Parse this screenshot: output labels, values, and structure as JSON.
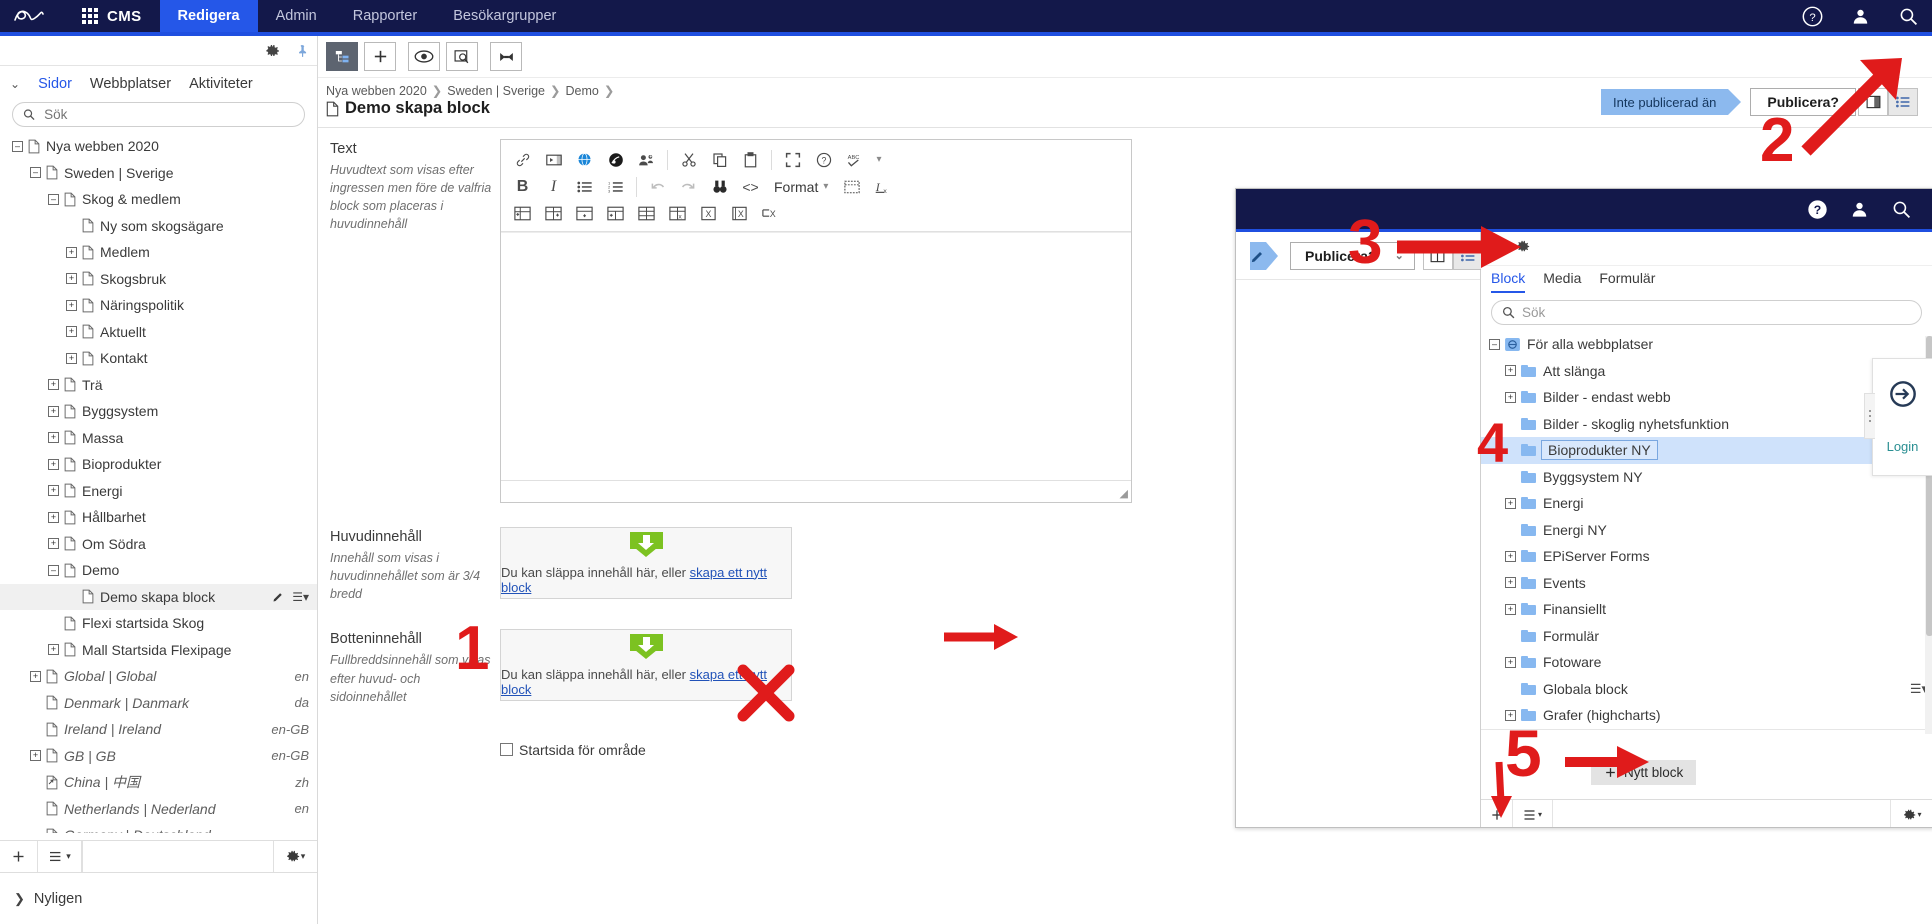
{
  "global_nav": {
    "logo": "epi-logo",
    "product": "CMS",
    "items": [
      {
        "label": "Redigera",
        "active": true
      },
      {
        "label": "Admin",
        "active": false
      },
      {
        "label": "Rapporter",
        "active": false
      },
      {
        "label": "Besökargrupper",
        "active": false
      }
    ],
    "right_icons": [
      "help-icon",
      "user-icon",
      "search-icon"
    ]
  },
  "left_pane": {
    "toolbar_icons": [
      "gear-icon",
      "pin-icon"
    ],
    "tabs": [
      {
        "label": "Sidor",
        "active": true
      },
      {
        "label": "Webbplatser",
        "active": false
      },
      {
        "label": "Aktiviteter",
        "active": false
      }
    ],
    "search_placeholder": "Sök",
    "search_value": "",
    "tree": [
      {
        "label": "Nya webben 2020",
        "depth": 0,
        "toggle": "minus",
        "italic": false,
        "lang": ""
      },
      {
        "label": "Sweden | Sverige",
        "depth": 1,
        "toggle": "minus",
        "italic": false,
        "lang": ""
      },
      {
        "label": "Skog & medlem",
        "depth": 2,
        "toggle": "minus",
        "italic": false,
        "lang": ""
      },
      {
        "label": "Ny som skogsägare",
        "depth": 3,
        "toggle": "none",
        "italic": false,
        "lang": ""
      },
      {
        "label": "Medlem",
        "depth": 3,
        "toggle": "plus",
        "italic": false,
        "lang": ""
      },
      {
        "label": "Skogsbruk",
        "depth": 3,
        "toggle": "plus",
        "italic": false,
        "lang": ""
      },
      {
        "label": "Näringspolitik",
        "depth": 3,
        "toggle": "plus",
        "italic": false,
        "lang": ""
      },
      {
        "label": "Aktuellt",
        "depth": 3,
        "toggle": "plus",
        "italic": false,
        "lang": ""
      },
      {
        "label": "Kontakt",
        "depth": 3,
        "toggle": "plus",
        "italic": false,
        "lang": ""
      },
      {
        "label": "Trä",
        "depth": 2,
        "toggle": "plus",
        "italic": false,
        "lang": ""
      },
      {
        "label": "Byggsystem",
        "depth": 2,
        "toggle": "plus",
        "italic": false,
        "lang": ""
      },
      {
        "label": "Massa",
        "depth": 2,
        "toggle": "plus",
        "italic": false,
        "lang": ""
      },
      {
        "label": "Bioprodukter",
        "depth": 2,
        "toggle": "plus",
        "italic": false,
        "lang": ""
      },
      {
        "label": "Energi",
        "depth": 2,
        "toggle": "plus",
        "italic": false,
        "lang": ""
      },
      {
        "label": "Hållbarhet",
        "depth": 2,
        "toggle": "plus",
        "italic": false,
        "lang": ""
      },
      {
        "label": "Om Södra",
        "depth": 2,
        "toggle": "plus",
        "italic": false,
        "lang": ""
      },
      {
        "label": "Demo",
        "depth": 2,
        "toggle": "minus",
        "italic": false,
        "lang": ""
      },
      {
        "label": "Demo skapa block",
        "depth": 3,
        "toggle": "none",
        "italic": false,
        "lang": "",
        "selected": true,
        "actions": true
      },
      {
        "label": "Flexi startsida Skog",
        "depth": 2,
        "toggle": "none",
        "italic": false,
        "lang": ""
      },
      {
        "label": "Mall Startsida Flexipage",
        "depth": 2,
        "toggle": "plus",
        "italic": false,
        "lang": ""
      },
      {
        "label": "Global | Global",
        "depth": 1,
        "toggle": "plus",
        "italic": true,
        "lang": "en"
      },
      {
        "label": "Denmark | Danmark",
        "depth": 1,
        "toggle": "none",
        "italic": true,
        "lang": "da"
      },
      {
        "label": "Ireland | Ireland",
        "depth": 1,
        "toggle": "none",
        "italic": true,
        "lang": "en-GB"
      },
      {
        "label": "GB | GB",
        "depth": 1,
        "toggle": "plus",
        "italic": true,
        "lang": "en-GB"
      },
      {
        "label": "China | 中国",
        "depth": 1,
        "toggle": "none",
        "italic": true,
        "lang": "zh",
        "shortcut": true
      },
      {
        "label": "Netherlands | Nederland",
        "depth": 1,
        "toggle": "none",
        "italic": true,
        "lang": "en"
      },
      {
        "label": "Germany | Deutschland",
        "depth": 1,
        "toggle": "none",
        "italic": true,
        "lang": "en"
      }
    ],
    "bottom_buttons": [
      "plus-icon",
      "hamburger-menu-icon",
      "gear-icon"
    ],
    "recent_label": "Nyligen"
  },
  "main": {
    "toolbar_icons": [
      "page-tree-icon",
      "plus-icon",
      "eye-icon",
      "preview-compare-icon",
      "expand-icon"
    ],
    "breadcrumb": [
      "Nya webben 2020",
      "Sweden | Sverige",
      "Demo"
    ],
    "page_title": "Demo skapa block",
    "status_chip": "Inte publicerad än",
    "publish_button": "Publicera?",
    "view_toggle_icons": [
      "panel-layout-icon",
      "list-view-icon"
    ],
    "fields": {
      "text": {
        "label": "Text",
        "description": "Huvudtext som visas efter ingressen men före de valfria block som placeras i huvudinnehåll",
        "value": ""
      },
      "huvudinnehall": {
        "label": "Huvudinnehåll",
        "description": "Innehåll som visas i huvudinnehållet som är 3/4 bredd",
        "drop_text": "Du kan släppa innehåll här, eller ",
        "drop_link": "skapa ett nytt block"
      },
      "botteninnehall": {
        "label": "Botteninnehåll",
        "description": "Fullbreddsinnehåll som visas efter huvud- och sidoinnehållet",
        "drop_text": "Du kan släppa innehåll här, eller ",
        "drop_link": "skapa ett nytt block"
      },
      "startsida_checkbox": {
        "label": "Startsida för område",
        "checked": false
      }
    },
    "rte_toolbar": {
      "row1": [
        "link-icon",
        "media-icon",
        "globe-icon",
        "anchor-icon",
        "personalize-icon",
        "cut-icon",
        "copy-icon",
        "paste-icon",
        "fullscreen-icon",
        "help-icon",
        "spellcheck-icon",
        "chevron-down-icon"
      ],
      "row2": [
        "bold-icon",
        "italic-icon",
        "bullet-list-icon",
        "numbered-list-icon",
        "undo-icon",
        "redo-icon",
        "find-replace-icon",
        "source-code-icon",
        "table-properties-icon",
        "remove-format-icon"
      ],
      "row2_format_label": "Format",
      "row3": [
        "insert-table-icon",
        "insert-row-icon",
        "insert-column-icon",
        "merge-cells-icon",
        "table-cell-icon",
        "delete-table-icon",
        "delete-row-icon",
        "delete-column-icon",
        "delete-cell-icon"
      ]
    }
  },
  "overlay": {
    "top_icons": [
      "help-icon",
      "user-icon",
      "search-icon"
    ],
    "left": {
      "pencil_icon": "edit-pencil-icon",
      "publish_button": "Publicera?",
      "view_toggle_icons": [
        "panel-layout-icon",
        "list-view-icon"
      ]
    },
    "right": {
      "toolbar_icons": [
        "pin-icon",
        "gear-icon"
      ],
      "tabs": [
        {
          "label": "Block",
          "active": true
        },
        {
          "label": "Media",
          "active": false
        },
        {
          "label": "Formulär",
          "active": false
        }
      ],
      "search_placeholder": "Sök",
      "tree": [
        {
          "label": "För alla webbplatser",
          "depth": 0,
          "toggle": "minus",
          "root": true
        },
        {
          "label": "Att slänga",
          "depth": 1,
          "toggle": "plus"
        },
        {
          "label": "Bilder - endast webb",
          "depth": 1,
          "toggle": "plus"
        },
        {
          "label": "Bilder - skoglig nyhetsfunktion",
          "depth": 1,
          "toggle": "none"
        },
        {
          "label": "Bioprodukter NY",
          "depth": 1,
          "toggle": "none",
          "selected": true,
          "menu": true
        },
        {
          "label": "Byggsystem NY",
          "depth": 1,
          "toggle": "none"
        },
        {
          "label": "Energi",
          "depth": 1,
          "toggle": "plus"
        },
        {
          "label": "Energi NY",
          "depth": 1,
          "toggle": "none"
        },
        {
          "label": "EPiServer Forms",
          "depth": 1,
          "toggle": "plus"
        },
        {
          "label": "Events",
          "depth": 1,
          "toggle": "plus"
        },
        {
          "label": "Finansiellt",
          "depth": 1,
          "toggle": "plus"
        },
        {
          "label": "Formulär",
          "depth": 1,
          "toggle": "none"
        },
        {
          "label": "Fotoware",
          "depth": 1,
          "toggle": "plus"
        },
        {
          "label": "Globala block",
          "depth": 1,
          "toggle": "none",
          "menu": true
        },
        {
          "label": "Grafer (highcharts)",
          "depth": 1,
          "toggle": "plus"
        }
      ],
      "new_block_button": "Nytt block",
      "bottom_buttons": [
        "plus-icon",
        "hamburger-menu-icon",
        "gear-icon"
      ]
    }
  },
  "login_widget": {
    "icon": "login-arrow-icon",
    "label": "Login"
  },
  "annotations": {
    "marker_color": "#e01b1b",
    "markers": [
      {
        "id": "1",
        "target": "huvudinnehall-field"
      },
      {
        "id": "2",
        "target": "assets-pane-toggle"
      },
      {
        "id": "3",
        "target": "overlay-pin-icon"
      },
      {
        "id": "4",
        "target": "bioprodukter-ny-folder"
      },
      {
        "id": "5",
        "target": "nytt-block-button"
      }
    ],
    "x_mark": "cross-over-skapa-nytt-block-link",
    "arrows": [
      "arrow-to-assets-pane",
      "arrow-to-pin",
      "arrow-to-rte-body",
      "arrow-to-nytt-block",
      "arrow-to-plus-bottom"
    ]
  }
}
